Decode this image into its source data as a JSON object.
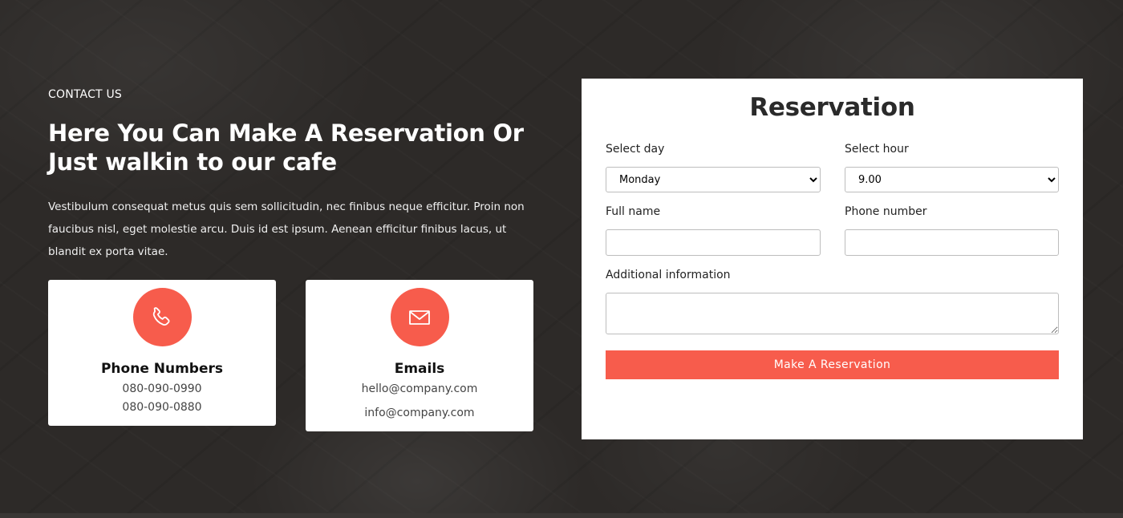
{
  "contact": {
    "eyebrow": "CONTACT US",
    "headline": "Here You Can Make A Reservation Or Just walkin to our cafe",
    "intro": "Vestibulum consequat metus quis sem sollicitudin, nec finibus neque efficitur. Proin non faucibus nisl, eget molestie arcu. Duis id est ipsum. Aenean efficitur finibus lacus, ut blandit ex porta vitae."
  },
  "cards": {
    "phone": {
      "icon": "phone-icon",
      "title": "Phone Numbers",
      "lines": [
        "080-090-0990",
        "080-090-0880"
      ]
    },
    "email": {
      "icon": "envelope-icon",
      "title": "Emails",
      "lines": [
        "hello@company.com",
        "info@company.com"
      ]
    }
  },
  "form": {
    "title": "Reservation",
    "day_label": "Select day",
    "day_value": "Monday",
    "hour_label": "Select hour",
    "hour_value": "9.00",
    "name_label": "Full name",
    "name_value": "",
    "phone_label": "Phone number",
    "phone_value": "",
    "info_label": "Additional information",
    "info_value": "",
    "submit_label": "Make A Reservation"
  },
  "colors": {
    "accent": "#f75c4c",
    "background": "#2d2a28",
    "panel": "#ffffff"
  }
}
